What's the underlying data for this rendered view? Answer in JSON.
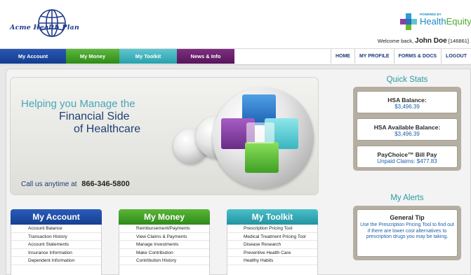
{
  "header": {
    "logo_text": "Acme Health Plan",
    "partner_powered": "POWERED BY",
    "partner_name_a": "Health",
    "partner_name_b": "Equity",
    "welcome_prefix": "Welcome back,",
    "user_name": "John Doe",
    "user_id": "[146861]"
  },
  "nav": {
    "tabs": [
      {
        "label": "My Account"
      },
      {
        "label": "My Money"
      },
      {
        "label": "My Toolkit"
      },
      {
        "label": "News & Info"
      }
    ],
    "links": [
      {
        "label": "HOME"
      },
      {
        "label": "MY PROFILE"
      },
      {
        "label": "FORMS & DOCS"
      },
      {
        "label": "LOGOUT"
      }
    ]
  },
  "hero": {
    "line1": "Helping you Manage the",
    "line2": "Financial Side",
    "line3": "of Healthcare",
    "call_text": "Call us anytime at",
    "phone": "866-346-5800"
  },
  "quick_stats": {
    "title": "Quick Stats",
    "items": [
      {
        "label": "HSA Balance:",
        "value": "$3,496.39"
      },
      {
        "label": "HSA Available Balance:",
        "value": "$3,496.39"
      },
      {
        "label": "PayChoice™ Bill Pay",
        "value": "Unpaid Claims: $477.83"
      }
    ]
  },
  "alerts": {
    "title": "My Alerts",
    "tip_title": "General Tip",
    "tip_text": "Use the Prescription Pricing Tool to find out if there are lower cost alternatives to prescription drugs you may be taking."
  },
  "columns": [
    {
      "title": "My Account",
      "color": "#1d4fa3",
      "items": [
        "Account Balance",
        "Transaction History",
        "Account Statements",
        "Insurance Information",
        "Dependent Information"
      ]
    },
    {
      "title": "My Money",
      "color": "#3f9a2a",
      "items": [
        "Reimbursement/Payments",
        "View Claims & Payments",
        "Manage Investments",
        "Make Contribution",
        "Contribution History"
      ]
    },
    {
      "title": "My Toolkit",
      "color": "#2aa2ad",
      "items": [
        "Prescription Pricing Tool",
        "Medical Treatment Pricing Tool",
        "Disease Research",
        "Preventive Health Care",
        "Healthy Habits"
      ]
    }
  ]
}
